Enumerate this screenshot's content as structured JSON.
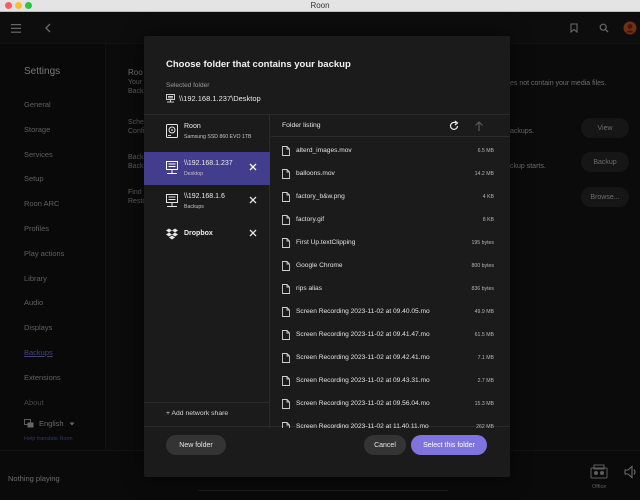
{
  "window": {
    "title": "Roon"
  },
  "sidebar": {
    "title": "Settings",
    "items": [
      {
        "label": "General"
      },
      {
        "label": "Storage"
      },
      {
        "label": "Services"
      },
      {
        "label": "Setup"
      },
      {
        "label": "Roon ARC"
      },
      {
        "label": "Profiles"
      },
      {
        "label": "Play actions"
      },
      {
        "label": "Library"
      },
      {
        "label": "Audio"
      },
      {
        "label": "Displays"
      },
      {
        "label": "Backups"
      },
      {
        "label": "Extensions"
      },
      {
        "label": "About"
      }
    ],
    "active_item": "Backups",
    "language": "English",
    "help_translate": "Help translate Roon"
  },
  "main": {
    "heading_fragment": "Roo",
    "texts": [
      "Your",
      "Back",
      "Sche",
      "Confi",
      "Back",
      "Back",
      "Find",
      "Resto"
    ],
    "media_note": "es not contain your media files.",
    "backups_note": "ackups.",
    "backup_starts_note": "ckup starts.",
    "buttons": {
      "view": "View",
      "backup": "Backup",
      "browse": "Browse..."
    }
  },
  "bottom": {
    "nothing_playing": "Nothing playing",
    "zone": "Office"
  },
  "dialog": {
    "title": "Choose folder that contains your backup",
    "selected_folder_label": "Selected folder",
    "selected_folder_path": "\\\\192.168.1.237\\Desktop",
    "locations": [
      {
        "name": "Roon",
        "sub": "Samsung SSD 860 EVO 1TB",
        "icon": "drive-icon",
        "removable": false
      },
      {
        "name": "\\\\192.168.1.237",
        "sub": "Desktop",
        "icon": "network-drive-icon",
        "removable": true
      },
      {
        "name": "\\\\192.168.1.6",
        "sub": "Backups",
        "icon": "network-drive-icon",
        "removable": true
      },
      {
        "name": "Dropbox",
        "sub": "",
        "icon": "dropbox-icon",
        "removable": true
      }
    ],
    "selected_location": "\\\\192.168.1.237",
    "add_network_share": "+ Add network share",
    "folder_listing_title": "Folder listing",
    "files": [
      {
        "name": "alterd_images.mov",
        "size": "6.5 MB"
      },
      {
        "name": "balloons.mov",
        "size": "14.2 MB"
      },
      {
        "name": "factory_b&w.png",
        "size": "4 KB"
      },
      {
        "name": "factory.gif",
        "size": "8 KB"
      },
      {
        "name": "First Up.textClipping",
        "size": "195 bytes"
      },
      {
        "name": "Google Chrome",
        "size": "800 bytes"
      },
      {
        "name": "rips alias",
        "size": "836 bytes"
      },
      {
        "name": "Screen Recording 2023-11-02 at 09.40.05.mo",
        "size": "49.9 MB"
      },
      {
        "name": "Screen Recording 2023-11-02 at 09.41.47.mo",
        "size": "61.5 MB"
      },
      {
        "name": "Screen Recording 2023-11-02 at 09.42.41.mo",
        "size": "7.1 MB"
      },
      {
        "name": "Screen Recording 2023-11-02 at 09.43.31.mo",
        "size": "2.7 MB"
      },
      {
        "name": "Screen Recording 2023-11-02 at 09.56.04.mo",
        "size": "15.3 MB"
      },
      {
        "name": "Screen Recording 2023-11-02 at 11.40.11.mo",
        "size": "262 MB"
      }
    ],
    "buttons": {
      "new_folder": "New folder",
      "cancel": "Cancel",
      "select": "Select this folder"
    }
  },
  "colors": {
    "accent": "#7f74df",
    "selected_row": "#433d8d",
    "dialog_bg": "#1b1b1b"
  }
}
